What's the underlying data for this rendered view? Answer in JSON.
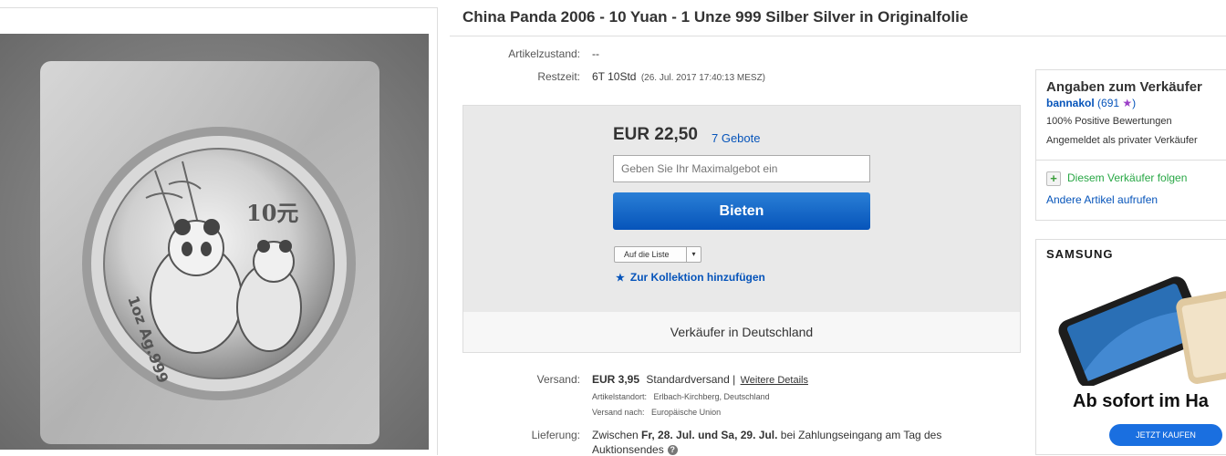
{
  "listing": {
    "title": "China Panda 2006 - 10 Yuan - 1 Unze 999 Silber Silver in Originalfolie"
  },
  "details": {
    "condition_label": "Artikelzustand:",
    "condition_value": "--",
    "time_label": "Restzeit:",
    "time_value": "6T 10Std",
    "time_end": "(26. Jul. 2017   17:40:13 MESZ)"
  },
  "bid": {
    "price": "EUR 22,50",
    "bids_link": "7 Gebote",
    "max_bid_placeholder": "Geben Sie Ihr Maximalgebot ein",
    "bid_button": "Bieten",
    "watchlist_label": "Auf die Liste",
    "watchlist_dropdown": "▾",
    "collection_label": "Zur Kollektion hinzufügen",
    "seller_country": "Verkäufer in Deutschland"
  },
  "shipping": {
    "label": "Versand:",
    "cost": "EUR 3,95",
    "method": "Standardversand |",
    "details_link": "Weitere Details",
    "location": "Artikelstandort:   Erlbach-Kirchberg, Deutschland",
    "ships_to": "Versand nach:   Europäische Union"
  },
  "delivery": {
    "label": "Lieferung:",
    "prefix": "Zwischen ",
    "date1": "Fr, 28. Jul.",
    "and": " und ",
    "date2": "Sa, 29. Jul.",
    "suffix": " bei Zahlungseingang am Tag des",
    "line2": "Auktionsendes",
    "info_icon": "?"
  },
  "seller": {
    "title": "Angaben zum Verkäufer",
    "name": "bannakol",
    "feedback_open": " (691 ",
    "star": "★",
    "feedback_close": ")",
    "positive": "100% Positive Bewertungen",
    "private": "Angemeldet als privater Verkäufer",
    "follow_icon": "+",
    "follow": "Diesem Verkäufer folgen",
    "other_items": "Andere Artikel aufrufen"
  },
  "ad": {
    "brand": "SAMSUNG",
    "headline": "Ab sofort im Ha",
    "cta": "JETZT KAUFEN"
  },
  "coin": {
    "denomination": "10元",
    "weight_text": "1oz Ag.999"
  },
  "colors": {
    "link": "#0654ba",
    "bid_button": "#0654ba",
    "follow_green": "#28a745",
    "star_purple": "#9b3fc7"
  }
}
